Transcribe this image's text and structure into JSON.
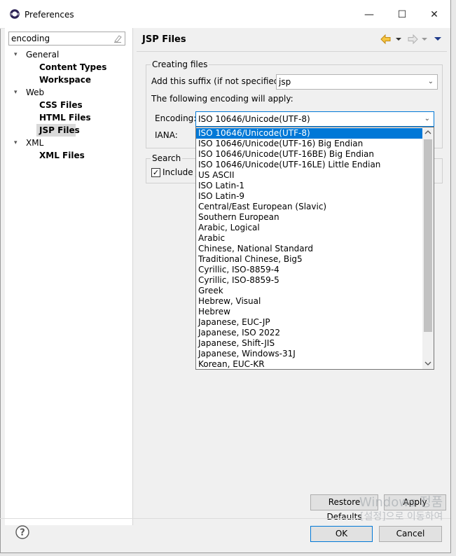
{
  "window": {
    "title": "Preferences",
    "controls": {
      "minimize": "—",
      "maximize": "☐",
      "close": "✕"
    }
  },
  "filter": {
    "value": "encoding"
  },
  "tree": [
    {
      "label": "General",
      "expanded": true
    },
    {
      "label": "Content Types"
    },
    {
      "label": "Workspace"
    },
    {
      "label": "Web",
      "expanded": true
    },
    {
      "label": "CSS Files"
    },
    {
      "label": "HTML Files"
    },
    {
      "label": "JSP Files",
      "selected": true
    },
    {
      "label": "XML",
      "expanded": true
    },
    {
      "label": "XML Files"
    }
  ],
  "page": {
    "title": "JSP Files",
    "nav_icons": [
      "back-arrow-icon",
      "back-dropdown-icon",
      "forward-arrow-icon",
      "forward-dropdown-icon",
      "view-menu-icon"
    ],
    "creating_files": {
      "group_label": "Creating files",
      "suffix_label": "Add this suffix (if not specified):",
      "suffix_value": "jsp",
      "encoding_note": "The following encoding will apply:",
      "encoding_label": "Encoding:",
      "encoding_value": "ISO 10646/Unicode(UTF-8)",
      "iana_label": "IANA:"
    },
    "search": {
      "group_label": "Search",
      "include_label": "Include J",
      "include_checked": true
    }
  },
  "encoding_options": [
    "ISO 10646/Unicode(UTF-8)",
    "ISO 10646/Unicode(UTF-16) Big Endian",
    "ISO 10646/Unicode(UTF-16BE) Big Endian",
    "ISO 10646/Unicode(UTF-16LE) Little Endian",
    "US ASCII",
    "ISO Latin-1",
    "ISO Latin-9",
    "Central/East European (Slavic)",
    "Southern European",
    "Arabic, Logical",
    "Arabic",
    "Chinese, National Standard",
    "Traditional Chinese, Big5",
    "Cyrillic, ISO-8859-4",
    "Cyrillic, ISO-8859-5",
    "Greek",
    "Hebrew, Visual",
    "Hebrew",
    "Japanese, EUC-JP",
    "Japanese, ISO 2022",
    "Japanese, Shift-JIS",
    "Japanese, Windows-31J",
    "Korean, EUC-KR"
  ],
  "buttons": {
    "restore_defaults": "Restore Defaults",
    "apply": "Apply",
    "ok": "OK",
    "cancel": "Cancel"
  },
  "watermark": {
    "line1": "Windows 정품",
    "line2": "[설정]으로 이동하여"
  },
  "colors": {
    "selection": "#0078d7",
    "accent_arrow": "#e8a317",
    "view_menu": "#1f3a8a"
  }
}
